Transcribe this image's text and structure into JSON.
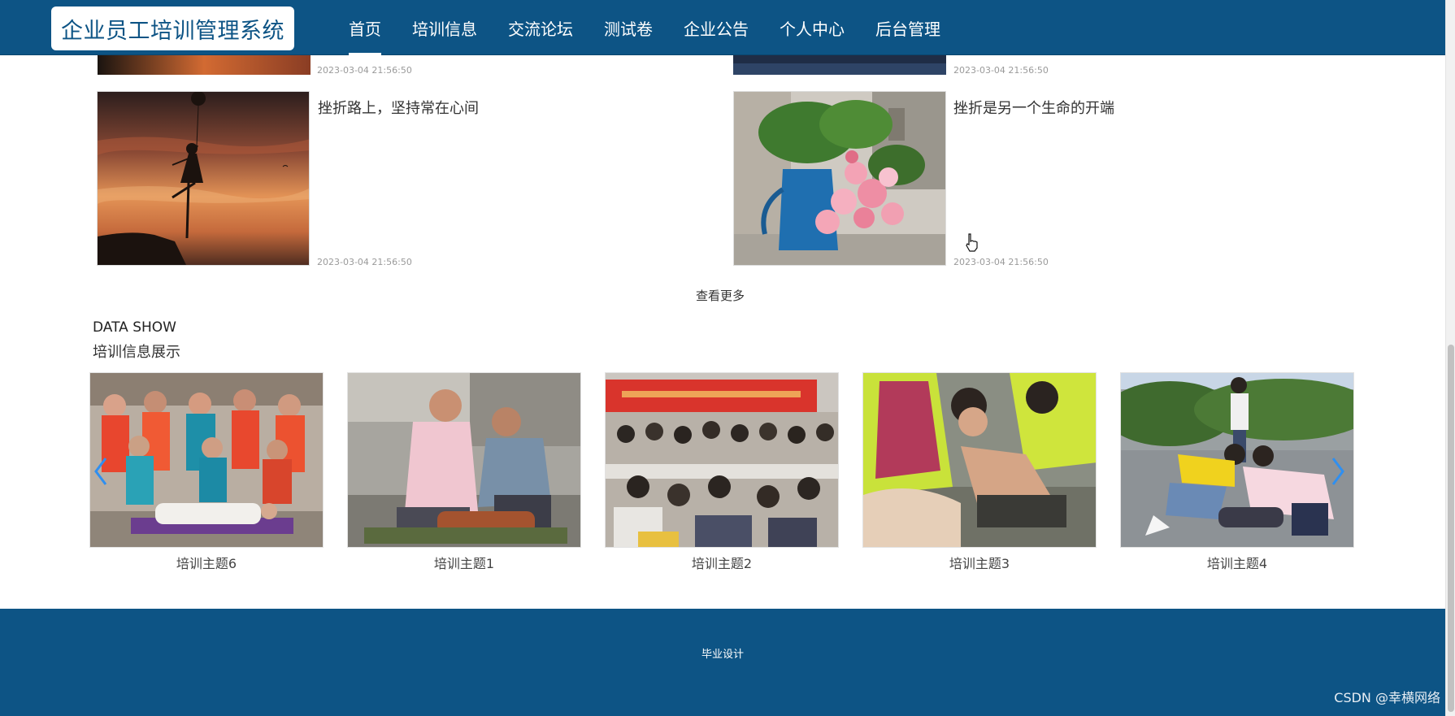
{
  "header": {
    "logo": "企业员工培训管理系统",
    "nav": [
      {
        "label": "首页",
        "active": true
      },
      {
        "label": "培训信息"
      },
      {
        "label": "交流论坛"
      },
      {
        "label": "测试卷"
      },
      {
        "label": "企业公告"
      },
      {
        "label": "个人中心"
      },
      {
        "label": "后台管理"
      }
    ]
  },
  "articles": {
    "partial_left_date": "2023-03-04 21:56:50",
    "partial_right_date": "2023-03-04 21:56:50",
    "items": [
      {
        "title": "挫折路上，坚持常在心间",
        "date": "2023-03-04 21:56:50"
      },
      {
        "title": "挫折是另一个生命的开端",
        "date": "2023-03-04 21:56:50"
      }
    ],
    "more_label": "查看更多"
  },
  "data_show": {
    "title": "DATA SHOW",
    "subtitle": "培训信息展示",
    "cards": [
      {
        "caption": "培训主题6"
      },
      {
        "caption": "培训主题1"
      },
      {
        "caption": "培训主题2"
      },
      {
        "caption": "培训主题3"
      },
      {
        "caption": "培训主题4"
      }
    ],
    "prev_icon": "chevron-left-icon",
    "next_icon": "chevron-right-icon"
  },
  "footer": {
    "text": "毕业设计"
  },
  "watermark": "CSDN @幸横网络",
  "colors": {
    "brand": "#0d5485",
    "arrow": "#2f8ff0"
  }
}
